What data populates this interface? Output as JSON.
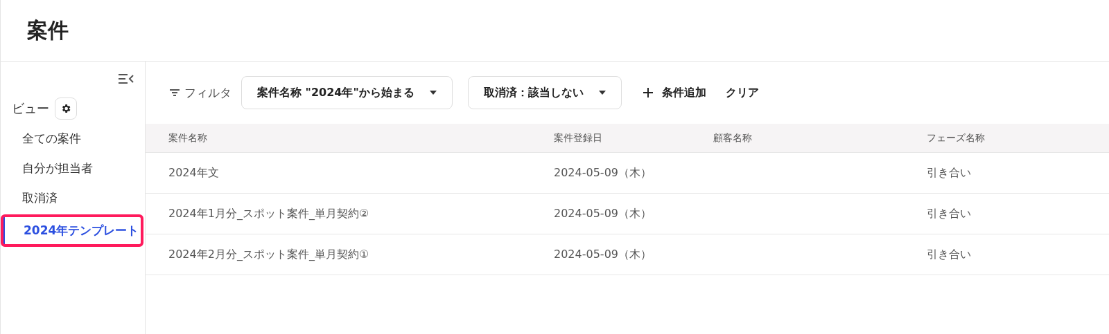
{
  "page": {
    "title": "案件"
  },
  "sidebar": {
    "heading": "ビュー",
    "items": [
      {
        "label": "全ての案件",
        "selected": false,
        "highlighted": false
      },
      {
        "label": "自分が担当者",
        "selected": false,
        "highlighted": false
      },
      {
        "label": "取消済",
        "selected": false,
        "highlighted": false
      },
      {
        "label": "2024年テンプレート",
        "selected": true,
        "highlighted": true
      }
    ]
  },
  "filter_bar": {
    "label": "フィルタ",
    "filters": [
      {
        "label": "案件名称 \"2024年\"から始まる"
      },
      {
        "label": "取消済：該当しない"
      }
    ],
    "add_label": "条件追加",
    "clear_label": "クリア"
  },
  "table": {
    "columns": [
      "案件名称",
      "案件登録日",
      "顧客名称",
      "フェーズ名称"
    ],
    "rows": [
      [
        "2024年文",
        "2024-05-09（木）",
        "",
        "引き合い"
      ],
      [
        "2024年1月分_スポット案件_単月契約②",
        "2024-05-09（木）",
        "",
        "引き合い"
      ],
      [
        "2024年2月分_スポット案件_単月契約①",
        "2024-05-09（木）",
        "",
        "引き合い"
      ]
    ]
  }
}
